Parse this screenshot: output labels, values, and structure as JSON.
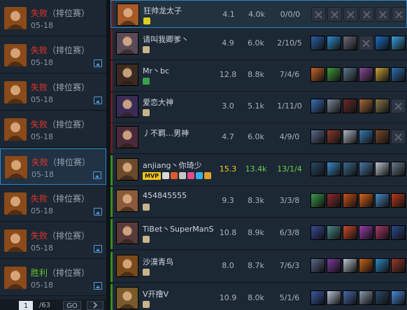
{
  "history": {
    "items": [
      {
        "result": "失败",
        "mode": "（排位赛）",
        "date": "05-18",
        "outcome": "loss",
        "share": false,
        "selected": false
      },
      {
        "result": "失败",
        "mode": "（排位赛）",
        "date": "05-18",
        "outcome": "loss",
        "share": true,
        "selected": false
      },
      {
        "result": "失败",
        "mode": "（排位赛）",
        "date": "05-18",
        "outcome": "loss",
        "share": true,
        "selected": false
      },
      {
        "result": "失败",
        "mode": "（排位赛）",
        "date": "05-18",
        "outcome": "loss",
        "share": false,
        "selected": false
      },
      {
        "result": "失败",
        "mode": "（排位赛）",
        "date": "05-18",
        "outcome": "loss",
        "share": true,
        "selected": true
      },
      {
        "result": "失败",
        "mode": "（排位赛）",
        "date": "05-18",
        "outcome": "loss",
        "share": true,
        "selected": false
      },
      {
        "result": "失败",
        "mode": "（排位赛）",
        "date": "05-18",
        "outcome": "loss",
        "share": true,
        "selected": false
      },
      {
        "result": "胜利",
        "mode": "（排位赛）",
        "date": "05-18",
        "outcome": "win",
        "share": true,
        "selected": false
      }
    ],
    "pager": {
      "current": "1",
      "total": "/63",
      "go_label": "GO",
      "next_icon": "chevron-right-icon"
    }
  },
  "colors": {
    "loss": "#e2352b",
    "win": "#62c12f",
    "accent": "#2d86c4",
    "mvp": "#f0c21a"
  },
  "board": {
    "players": [
      {
        "name": "狂帅龙太子",
        "score": "4.1",
        "gold": "4.0k",
        "kda": "0/0/0",
        "team": "red",
        "me": true,
        "items": [
          "empty",
          "empty",
          "empty",
          "empty",
          "empty",
          "empty"
        ],
        "avatar": "#a65a2a"
      },
      {
        "name": "请叫我卿爹丶",
        "score": "4.9",
        "gold": "6.0k",
        "kda": "2/10/5",
        "team": "red",
        "me": false,
        "items": [
          "#2b5fa8",
          "#2e8fcf",
          "#6b6b7a",
          "empty",
          "#1c6fc4",
          "#3aa3e0"
        ],
        "avatar": "#5a4a58"
      },
      {
        "name": "Mr丶bc",
        "score": "12.8",
        "gold": "8.8k",
        "kda": "7/4/6",
        "team": "red",
        "me": false,
        "items": [
          "#c8642a",
          "#3f9a3a",
          "#5c7a8a",
          "#8a4a9a",
          "#c9a23a",
          "#2e6fb0"
        ],
        "avatar": "#3a2a22"
      },
      {
        "name": "爱恋大神",
        "score": "3.0",
        "gold": "5.1k",
        "kda": "1/11/0",
        "team": "red",
        "me": false,
        "items": [
          "#3b6fb8",
          "#7a8a99",
          "#6b2a2a",
          "#a86a3a",
          "#8a7a4a",
          "empty"
        ],
        "avatar": "#3a2c55"
      },
      {
        "name": "丿不羁…男神",
        "score": "4.7",
        "gold": "6.0k",
        "kda": "4/9/0",
        "team": "red",
        "me": false,
        "items": [
          "#5a6a8a",
          "#8a3a2a",
          "#b0b8c4",
          "#3a7ab0",
          "#7a4a2a",
          "empty"
        ],
        "avatar": "#4a2a3a"
      },
      {
        "name": "anjiang丶你琦少",
        "score": "15.3",
        "gold": "13.4k",
        "kda": "13/1/4",
        "team": "green",
        "me": false,
        "mvp": true,
        "items": [
          "#2a4a6a",
          "#3a8ac4",
          "#3a6a8a",
          "#4a7aa8",
          "#b8c4ce",
          "#6a7a8a"
        ],
        "avatar": "#6a4a2a"
      },
      {
        "name": "454845555",
        "score": "9.3",
        "gold": "8.3k",
        "kda": "3/3/8",
        "team": "green",
        "me": false,
        "items": [
          "#3a9a4a",
          "#8a2a2a",
          "#c8501a",
          "#d9641a",
          "#4a8ac4",
          "#b83a1a"
        ],
        "avatar": "#8a5a3a"
      },
      {
        "name": "TiBet丶SuperManS",
        "score": "10.8",
        "gold": "8.9k",
        "kda": "6/3/8",
        "team": "green",
        "me": false,
        "items": [
          "#3a4a9a",
          "#4a8a8a",
          "#c84a2a",
          "#9a3ab0",
          "#a83a6a",
          "#2a4a8a"
        ],
        "avatar": "#5a3a3a"
      },
      {
        "name": "沙漠青鸟",
        "score": "8.0",
        "gold": "8.7k",
        "kda": "7/6/3",
        "team": "green",
        "me": false,
        "items": [
          "#5a6a8a",
          "#7a3a9a",
          "#b8c4ce",
          "#c8641a",
          "#2a8ac4",
          "#9a3a2a"
        ],
        "avatar": "#7a4a1a"
      },
      {
        "name": "V开撸V",
        "score": "10.9",
        "gold": "8.0k",
        "kda": "5/1/6",
        "team": "green",
        "me": false,
        "items": [
          "#3a5aa8",
          "#b8c4d8",
          "#4a6aa8",
          "#8a9aaa",
          "#2a4a6a",
          "#4a8ad8"
        ],
        "avatar": "#7a5a2a"
      }
    ]
  }
}
